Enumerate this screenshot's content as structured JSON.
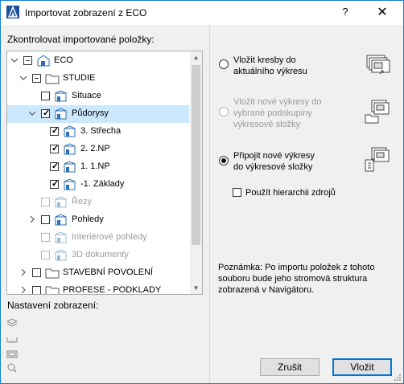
{
  "window": {
    "title": "Importovat zobrazení z ECO",
    "help": "?",
    "close": "✕"
  },
  "left": {
    "tree_label": "Zkontrolovat importované položky:",
    "view_settings_label": "Nastavení zobrazení:",
    "tree": [
      {
        "label": "ECO",
        "icon": "project-icon",
        "state": "partial",
        "expander": "collapse"
      },
      {
        "label": "STUDIE",
        "icon": "folder-icon",
        "state": "partial",
        "expander": "collapse"
      },
      {
        "label": "Situace",
        "icon": "view-icon",
        "state": "unchecked",
        "expander": "none"
      },
      {
        "label": "Půdorysy",
        "icon": "view-icon",
        "state": "checked",
        "expander": "collapse",
        "selected": true
      },
      {
        "label": "3. Střecha",
        "icon": "view-icon",
        "state": "checked",
        "expander": "none"
      },
      {
        "label": "2. 2.NP",
        "icon": "view-icon",
        "state": "checked",
        "expander": "none"
      },
      {
        "label": "1. 1.NP",
        "icon": "view-icon",
        "state": "checked",
        "expander": "none"
      },
      {
        "label": "-1. Základy",
        "icon": "view-icon",
        "state": "checked",
        "expander": "none"
      },
      {
        "label": "Řezy",
        "icon": "view-icon",
        "state": "unchecked",
        "expander": "none",
        "disabled": true
      },
      {
        "label": "Pohledy",
        "icon": "view-icon",
        "state": "unchecked",
        "expander": "expand"
      },
      {
        "label": "Interiérové pohledy",
        "icon": "view-icon",
        "state": "unchecked",
        "expander": "none",
        "disabled": true
      },
      {
        "label": "3D dokumenty",
        "icon": "view-icon",
        "state": "unchecked",
        "expander": "none",
        "disabled": true
      },
      {
        "label": "STAVEBNÍ POVOLENÍ",
        "icon": "folder-icon",
        "state": "unchecked",
        "expander": "expand"
      },
      {
        "label": "PROFESE - PODKLADY",
        "icon": "folder-icon",
        "state": "unchecked",
        "expander": "expand"
      }
    ],
    "view_setting_icons": [
      "layers-icon",
      "dimension-icon",
      "frame-icon",
      "zoom-icon"
    ]
  },
  "right": {
    "options": [
      {
        "text": "Vložit kresby do\naktuálního výkresu",
        "selected": false,
        "disabled": false,
        "icon": "place-drawings-icon"
      },
      {
        "text": "Vložit nové výkresy do\nvybrané podskupiny\nvýkresové složky",
        "selected": false,
        "disabled": true,
        "icon": "new-layouts-subset-icon"
      },
      {
        "text": "Připojit nové výkresy\ndo výkresové složky",
        "selected": true,
        "disabled": false,
        "icon": "append-layouts-icon"
      }
    ],
    "hierarchy_checkbox": {
      "label": "Použít hierarchii zdrojů",
      "checked": false
    },
    "note": "Poznámka: Po importu položek z tohoto souboru bude jeho stromová struktura zobrazená v Navigátoru.",
    "cancel_label": "Zrušit",
    "ok_label": "Vložit"
  },
  "colors": {
    "accent": "#0078d7",
    "selection": "#cce8ff",
    "window_border": "#1883d7"
  }
}
